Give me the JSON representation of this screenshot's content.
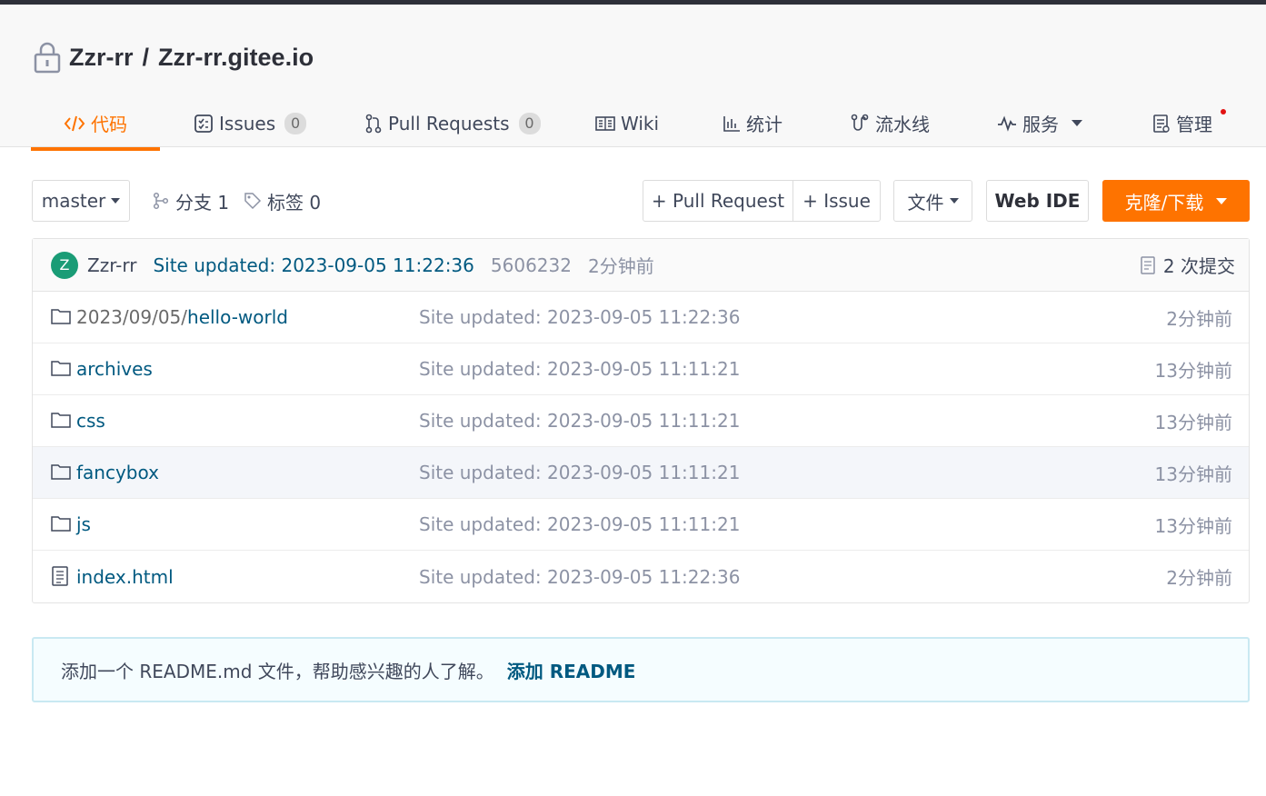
{
  "repo": {
    "owner": "Zzr-rr",
    "separator": "/",
    "name": "Zzr-rr.gitee.io"
  },
  "tabs": [
    {
      "label": "代码",
      "icon": "code-icon",
      "active": true
    },
    {
      "label": "Issues",
      "icon": "issues-icon",
      "count": "0"
    },
    {
      "label": "Pull Requests",
      "icon": "pull-request-icon",
      "count": "0"
    },
    {
      "label": "Wiki",
      "icon": "wiki-icon"
    },
    {
      "label": "统计",
      "icon": "stats-icon"
    },
    {
      "label": "流水线",
      "icon": "pipeline-icon"
    },
    {
      "label": "服务",
      "icon": "service-icon"
    },
    {
      "label": "管理",
      "icon": "manage-icon"
    }
  ],
  "toolbar": {
    "branch": "master",
    "branches_label": "分支 1",
    "tags_label": "标签 0",
    "pull_request_btn": "+ Pull Request",
    "issue_btn": "+ Issue",
    "file_btn": "文件",
    "webide_btn": "Web IDE",
    "clone_btn": "克隆/下载"
  },
  "commit": {
    "avatar_letter": "Z",
    "author": "Zzr-rr",
    "message": "Site updated: 2023-09-05 11:22:36",
    "hash": "5606232",
    "time": "2分钟前",
    "commits_count": "2 次提交"
  },
  "files": [
    {
      "type": "folder",
      "prefix": "2023/09/05/",
      "name": "hello-world",
      "message": "Site updated: 2023-09-05 11:22:36",
      "time": "2分钟前"
    },
    {
      "type": "folder",
      "prefix": "",
      "name": "archives",
      "message": "Site updated: 2023-09-05 11:11:21",
      "time": "13分钟前"
    },
    {
      "type": "folder",
      "prefix": "",
      "name": "css",
      "message": "Site updated: 2023-09-05 11:11:21",
      "time": "13分钟前"
    },
    {
      "type": "folder",
      "prefix": "",
      "name": "fancybox",
      "message": "Site updated: 2023-09-05 11:11:21",
      "time": "13分钟前"
    },
    {
      "type": "folder",
      "prefix": "",
      "name": "js",
      "message": "Site updated: 2023-09-05 11:11:21",
      "time": "13分钟前"
    },
    {
      "type": "file",
      "prefix": "",
      "name": "index.html",
      "message": "Site updated: 2023-09-05 11:22:36",
      "time": "2分钟前"
    }
  ],
  "readme": {
    "text": "添加一个 README.md 文件，帮助感兴趣的人了解。",
    "link": "添加 README"
  },
  "colors": {
    "accent": "#fe7300",
    "link": "#005980",
    "avatar": "#1a9c76"
  }
}
